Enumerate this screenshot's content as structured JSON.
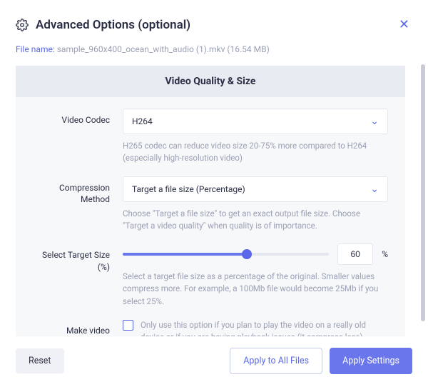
{
  "header": {
    "title": "Advanced Options (optional)"
  },
  "file": {
    "label": "File name: ",
    "value": "sample_960x400_ocean_with_audio (1).mkv (16.54 MB)"
  },
  "card": {
    "heading": "Video Quality & Size"
  },
  "codec": {
    "label": "Video Codec",
    "value": "H264",
    "help": "H265 codec can reduce video size 20-75% more compared to H264 (especially high-resolution video)"
  },
  "compression": {
    "label": "Compression Method",
    "value": "Target a file size (Percentage)",
    "help": "Choose \"Target a file size\" to get an exact output file size. Choose \"Target a video quality\" when quality is of importance."
  },
  "target": {
    "label": "Select Target Size (%)",
    "value": "60",
    "percent": "%",
    "help": "Select a target file size as a percentage of the original. Smaller values compress more. For example, a 100Mb file would become 25Mb if you select 25%."
  },
  "compat": {
    "label": "Make video compatible with old devices?",
    "help": "Only use this option if you plan to play the video on a really old device or if you are having playback issues (it compress less)"
  },
  "footer": {
    "reset": "Reset",
    "apply_all": "Apply to All Files",
    "apply": "Apply Settings"
  }
}
